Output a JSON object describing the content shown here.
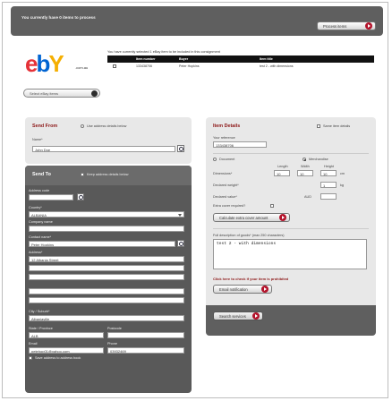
{
  "topbar": {
    "message": "You currently have 0 items to process",
    "process_button": "Process items"
  },
  "brand": {
    "logo_e": "e",
    "logo_b": "b",
    "logo_a": "a",
    "logo_y": "Y",
    "suffix": ".com.au"
  },
  "consignment": {
    "notice": "You have currently selected 1 eBay item to be included in this consignment",
    "headers": [
      "Item number",
      "Buyer",
      "Item title"
    ],
    "row": {
      "item_number": "133438706",
      "buyer": "Peter Hopkins",
      "title": "test 2 - with dimensions"
    },
    "select_button": "Select eBay items"
  },
  "send_from": {
    "title": "Send From",
    "option_label": "Use address details below",
    "name_label": "Name*",
    "name_value": "John Doe"
  },
  "send_to": {
    "title": "Send To",
    "option_label": "Keep address details below",
    "address_code_label": "Address code",
    "country_label": "Country*",
    "country_value": "ALBANIA",
    "company_label": "Company name",
    "contact_label": "Contact name*",
    "contact_value": "Peter Hopkins",
    "address_label": "Address*",
    "address_value": "12 Albania Street",
    "city_label": "City / Suburb*",
    "city_value": "Albaniaville",
    "state_label": "State / Province",
    "state_value": "ALB",
    "postcode_label": "Postcode",
    "email_label": "Email",
    "email_value": "petehop01@yahoo.com",
    "phone_label": "Phone",
    "phone_value": "03932469",
    "save_label": "Save address to address book"
  },
  "item_details": {
    "title": "Item Details",
    "same_label": "Same item details",
    "reference_label": "Your reference",
    "reference_value": "133438706",
    "document_label": "Document",
    "merchandise_label": "Merchandise",
    "dim_headers": [
      "Length",
      "Width",
      "Height"
    ],
    "dimensions_label": "Dimensions*",
    "dim_values": [
      "10",
      "10",
      "10"
    ],
    "dim_unit": "cm",
    "weight_label": "Declared weight*",
    "weight_value": "1",
    "weight_unit": "kg",
    "value_label": "Declared value*",
    "value_currency": "AUD",
    "extra_cover_label": "Extra cover required?",
    "calc_button": "Calculate extra cover amount",
    "description_label": "Full description of goods* (max 250 characters)",
    "description_value": "test 2 - with dimensions",
    "prohibited_link": "Click here to check if your item is prohibited",
    "email_button": "Email notification",
    "search_button": "Search services"
  },
  "colors": {
    "accent": "#8c1616",
    "go": "#b3122a",
    "panel": "#e8e8e8",
    "dark_panel": "#595959"
  },
  "icons": [
    "search-icon",
    "lookup-icon",
    "arrow-right-icon",
    "chevron-down-icon"
  ]
}
